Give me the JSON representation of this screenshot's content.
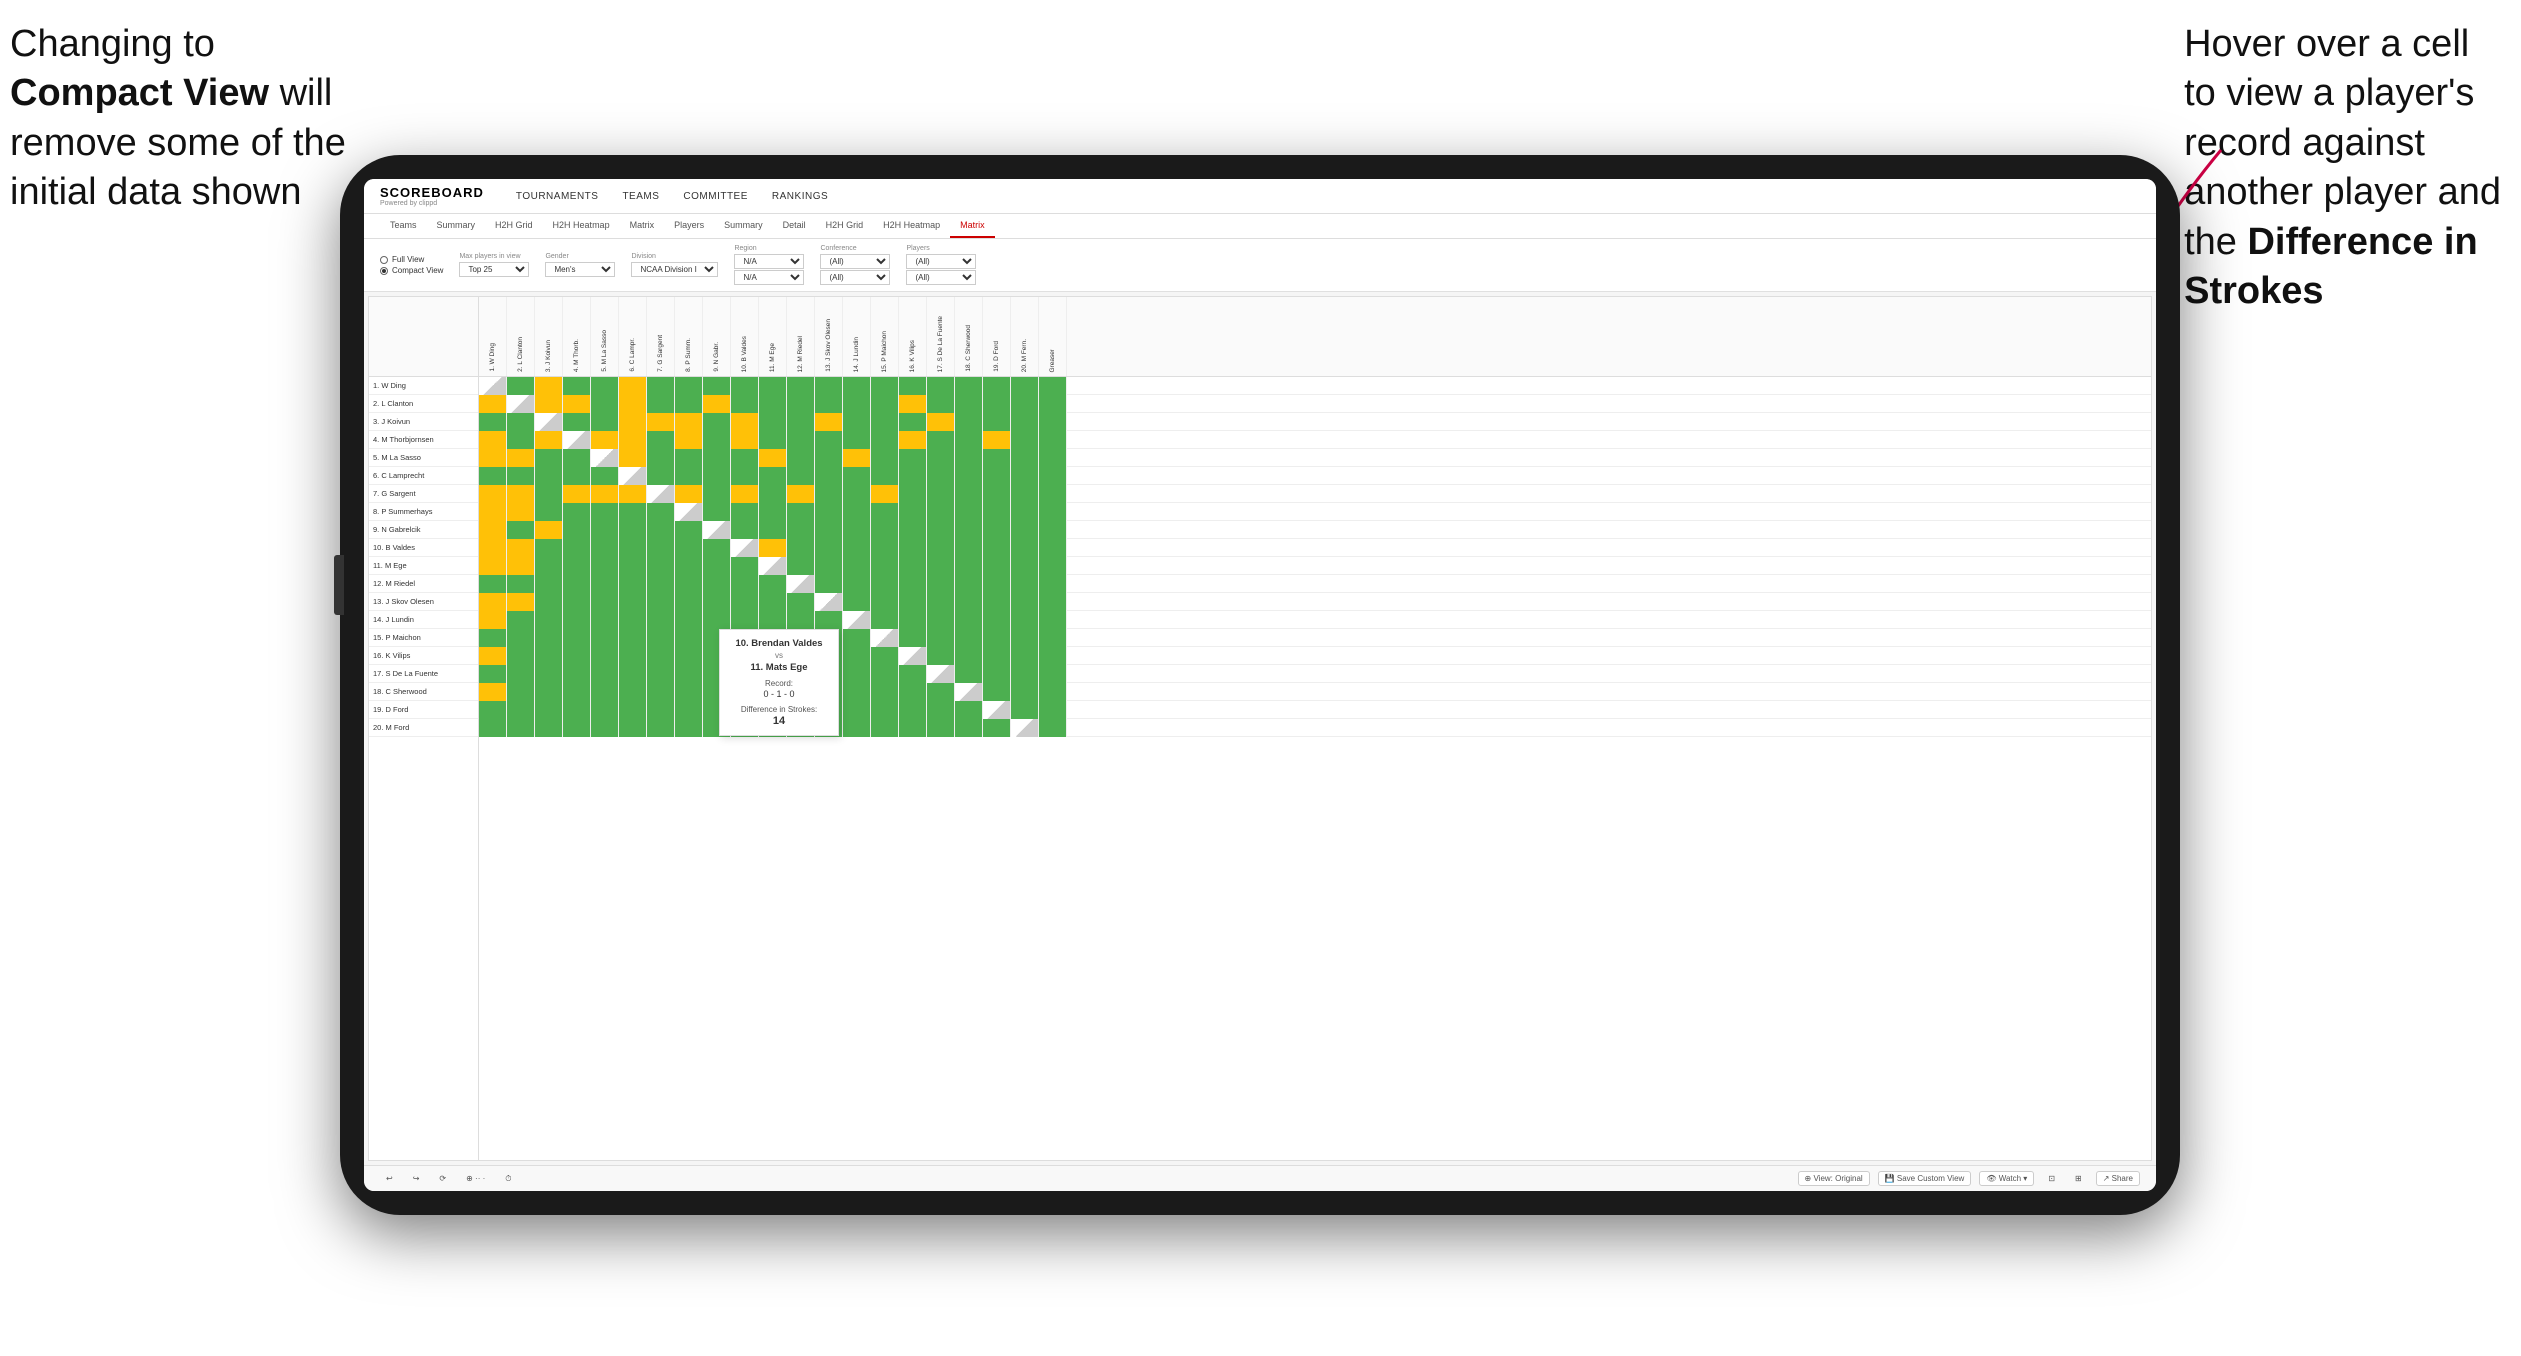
{
  "annotations": {
    "left": {
      "line1": "Changing to",
      "line2_bold": "Compact View",
      "line2_rest": " will",
      "line3": "remove some of the",
      "line4": "initial data shown"
    },
    "right": {
      "line1": "Hover over a cell",
      "line2": "to view a player's",
      "line3": "record against",
      "line4": "another player and",
      "line5_pre": "the ",
      "line5_bold": "Difference in",
      "line6_bold": "Strokes"
    }
  },
  "app": {
    "logo": "SCOREBOARD",
    "logo_sub": "Powered by clippd",
    "nav": [
      "TOURNAMENTS",
      "TEAMS",
      "COMMITTEE",
      "RANKINGS"
    ],
    "tabs_primary": [
      "Teams",
      "Summary",
      "H2H Grid",
      "H2H Heatmap",
      "Matrix",
      "Players",
      "Summary",
      "Detail",
      "H2H Grid",
      "H2H Heatmap",
      "Matrix"
    ],
    "active_tab": "Matrix"
  },
  "filters": {
    "view_options": [
      "Full View",
      "Compact View"
    ],
    "selected_view": "Compact View",
    "max_players_label": "Max players in view",
    "max_players_value": "Top 25",
    "gender_label": "Gender",
    "gender_value": "Men's",
    "division_label": "Division",
    "division_value": "NCAA Division I",
    "region_label": "Region",
    "region_values": [
      "N/A",
      "N/A"
    ],
    "conference_label": "Conference",
    "conference_values": [
      "(All)",
      "(All)"
    ],
    "players_label": "Players",
    "players_values": [
      "(All)",
      "(All)"
    ]
  },
  "matrix": {
    "rows": [
      "1. W Ding",
      "2. L Clanton",
      "3. J Koivun",
      "4. M Thorbjornsen",
      "5. M La Sasso",
      "6. C Lamprecht",
      "7. G Sargent",
      "8. P Summerhays",
      "9. N Gabrelcik",
      "10. B Valdes",
      "11. M Ege",
      "12. M Riedel",
      "13. J Skov Olesen",
      "14. J Lundin",
      "15. P Maichon",
      "16. K Vilips",
      "17. S De La Fuente",
      "18. C Sherwood",
      "19. D Ford",
      "20. M Ford"
    ],
    "col_headers": [
      "1. W Ding",
      "2. L Clanton",
      "3. J Koivun",
      "4. M Thorb.",
      "5. M La Sasso",
      "6. C Lampr.",
      "7. G Sargent",
      "8. P Summ.",
      "9. N Gabr.",
      "10. B Valdes",
      "11. M Ege",
      "12. M Riedel",
      "13. J Skov Olesen",
      "14. J Lundin",
      "15. P Maichon",
      "16. K Vilips",
      "17. S De La Fuente",
      "18. C Sherwood",
      "19. D Ford",
      "20. M Fern.",
      "Greaser"
    ]
  },
  "tooltip": {
    "player1": "10. Brendan Valdes",
    "vs": "vs",
    "player2": "11. Mats Ege",
    "record_label": "Record:",
    "record": "0 - 1 - 0",
    "diff_label": "Difference in Strokes:",
    "diff": "14"
  },
  "toolbar": {
    "undo": "↩",
    "redo": "↪",
    "view_original": "View: Original",
    "save_custom": "Save Custom View",
    "watch": "Watch ▾",
    "share": "Share"
  }
}
